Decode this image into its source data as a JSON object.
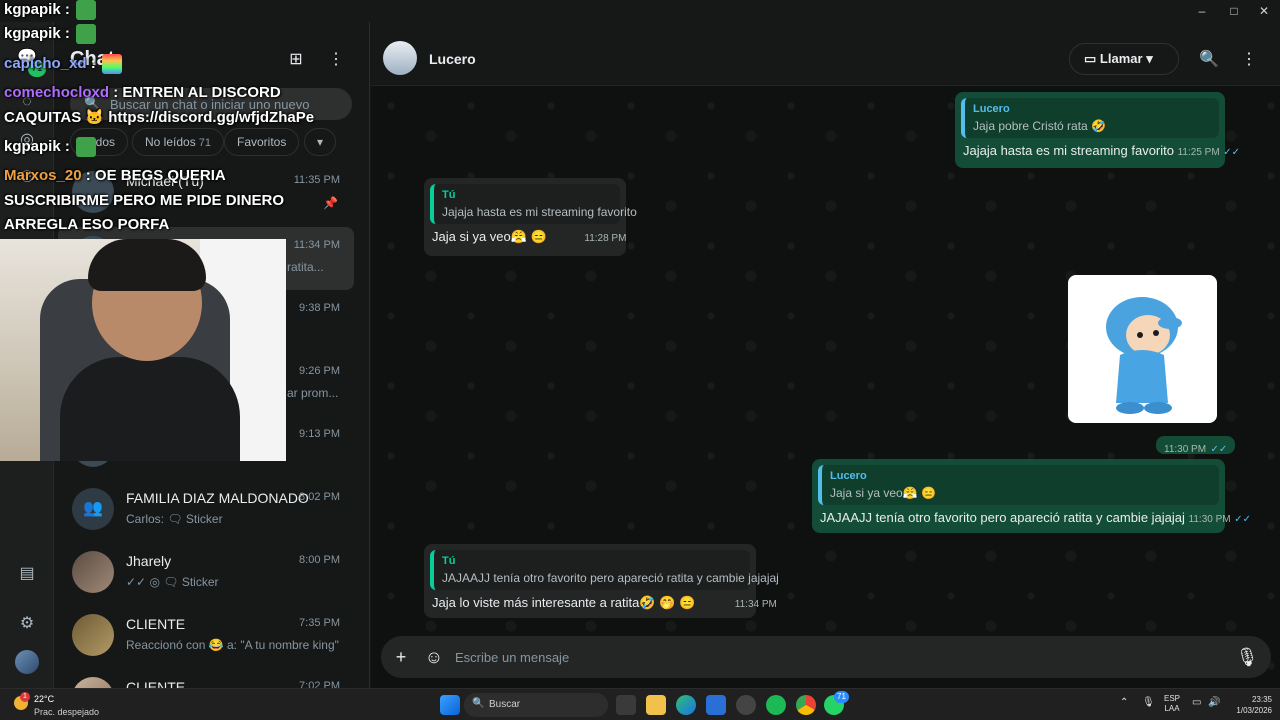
{
  "window": {
    "minimize": "–",
    "maximize": "□",
    "close": "✕"
  },
  "rail": {
    "app_title": "WhatsApp",
    "unread_badge": "71"
  },
  "sidebar": {
    "title": "Chat",
    "search_placeholder": "Buscar un chat o iniciar uno nuevo",
    "chips": [
      {
        "label": "Todos",
        "count": ""
      },
      {
        "label": "No leídos",
        "count": "71"
      },
      {
        "label": "Favoritos",
        "count": ""
      },
      {
        "label": "▾",
        "count": ""
      }
    ],
    "chats": [
      {
        "name": "Michael (Tú)",
        "time": "11:35 PM",
        "preview": ""
      },
      {
        "name": "",
        "time": "11:34 PM",
        "preview": "ratita..."
      },
      {
        "name": "",
        "time": "9:38 PM",
        "preview": ""
      },
      {
        "name": "",
        "time": "9:26 PM",
        "preview": "ar prom..."
      },
      {
        "name": "",
        "time": "9:13 PM",
        "preview": ""
      },
      {
        "name": "FAMILIA DIAZ MALDONADO",
        "time": "8:02 PM",
        "preview": "Carlos: 🗨 Sticker"
      },
      {
        "name": "Jharely",
        "time": "8:00 PM",
        "preview": "✓✓ ◎ 🗨 Sticker"
      },
      {
        "name": "CLIENTE",
        "time": "7:35 PM",
        "preview": "Reaccionó con 😂 a: \"A tu nombre king\""
      },
      {
        "name": "CLIENTE",
        "time": "7:02 PM",
        "preview": ""
      }
    ]
  },
  "header": {
    "contact_name": "Lucero",
    "call_label": "Llamar"
  },
  "messages": [
    {
      "dir": "out",
      "quote_author": "Lucero",
      "quote_text": "Jaja pobre Cristó rata 🤣",
      "text": "Jajaja hasta es mi streaming favorito",
      "time": "11:25 PM"
    },
    {
      "dir": "in",
      "quote_author": "Tú",
      "quote_text": "Jajaja hasta es mi streaming favorito",
      "text": "Jaja si ya veo😤 😑",
      "time": "11:28 PM"
    },
    {
      "dir": "out",
      "sticker": "pocoyo-sticker",
      "time": "11:30 PM"
    },
    {
      "dir": "out",
      "quote_author": "Lucero",
      "quote_text": "Jaja si ya veo😤 😑",
      "text": "JAJAAJJ tenía otro favorito pero apareció ratita y cambie jajajaj",
      "time": "11:30 PM"
    },
    {
      "dir": "in",
      "quote_author": "Tú",
      "quote_text": "JAJAAJJ tenía otro favorito pero apareció ratita y cambie jajajaj",
      "text": "Jaja lo viste más interesante a ratita🤣 🤭 😑",
      "time": "11:34 PM"
    }
  ],
  "composer": {
    "placeholder": "Escribe un mensaje"
  },
  "stream_overlay": {
    "lines": [
      {
        "user": "kgpapik",
        "text": ":"
      },
      {
        "user": "kgpapik",
        "text": ":"
      },
      {
        "user": "capicho_xd",
        "text": ":"
      },
      {
        "user": "comechocloxd",
        "text": ": ENTREN AL DISCORD"
      },
      {
        "user": "",
        "text": "CAQUITAS 🐱 https://discord.gg/wfjdZhaPe"
      },
      {
        "user": "kgpapik",
        "text": ":"
      },
      {
        "user": "Marxos_20",
        "text": ": OE BEGS QUERIA"
      },
      {
        "user": "",
        "text": "SUSCRIBIRME PERO ME PIDE DINERO"
      },
      {
        "user": "",
        "text": "ARREGLA ESO PORFA"
      }
    ]
  },
  "taskbar": {
    "temperature": "22°C",
    "condition": "Prac. despejado",
    "alert_count": "1",
    "search_label": "Buscar",
    "lang_top": "ESP",
    "lang_bottom": "LAA",
    "clock_time": "23:35",
    "clock_date": "1/03/2026",
    "whatsapp_badge": "71"
  }
}
